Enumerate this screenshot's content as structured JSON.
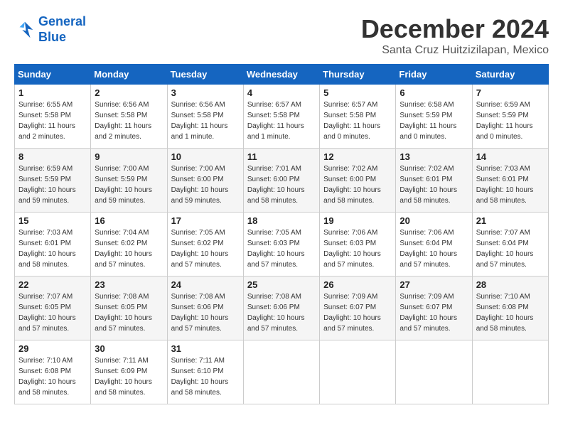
{
  "header": {
    "logo_line1": "General",
    "logo_line2": "Blue",
    "month": "December 2024",
    "location": "Santa Cruz Huitzizilapan, Mexico"
  },
  "weekdays": [
    "Sunday",
    "Monday",
    "Tuesday",
    "Wednesday",
    "Thursday",
    "Friday",
    "Saturday"
  ],
  "weeks": [
    [
      {
        "day": "1",
        "sunrise": "6:55 AM",
        "sunset": "5:58 PM",
        "daylight": "11 hours and 2 minutes."
      },
      {
        "day": "2",
        "sunrise": "6:56 AM",
        "sunset": "5:58 PM",
        "daylight": "11 hours and 2 minutes."
      },
      {
        "day": "3",
        "sunrise": "6:56 AM",
        "sunset": "5:58 PM",
        "daylight": "11 hours and 1 minute."
      },
      {
        "day": "4",
        "sunrise": "6:57 AM",
        "sunset": "5:58 PM",
        "daylight": "11 hours and 1 minute."
      },
      {
        "day": "5",
        "sunrise": "6:57 AM",
        "sunset": "5:58 PM",
        "daylight": "11 hours and 0 minutes."
      },
      {
        "day": "6",
        "sunrise": "6:58 AM",
        "sunset": "5:59 PM",
        "daylight": "11 hours and 0 minutes."
      },
      {
        "day": "7",
        "sunrise": "6:59 AM",
        "sunset": "5:59 PM",
        "daylight": "11 hours and 0 minutes."
      }
    ],
    [
      {
        "day": "8",
        "sunrise": "6:59 AM",
        "sunset": "5:59 PM",
        "daylight": "10 hours and 59 minutes."
      },
      {
        "day": "9",
        "sunrise": "7:00 AM",
        "sunset": "5:59 PM",
        "daylight": "10 hours and 59 minutes."
      },
      {
        "day": "10",
        "sunrise": "7:00 AM",
        "sunset": "6:00 PM",
        "daylight": "10 hours and 59 minutes."
      },
      {
        "day": "11",
        "sunrise": "7:01 AM",
        "sunset": "6:00 PM",
        "daylight": "10 hours and 58 minutes."
      },
      {
        "day": "12",
        "sunrise": "7:02 AM",
        "sunset": "6:00 PM",
        "daylight": "10 hours and 58 minutes."
      },
      {
        "day": "13",
        "sunrise": "7:02 AM",
        "sunset": "6:01 PM",
        "daylight": "10 hours and 58 minutes."
      },
      {
        "day": "14",
        "sunrise": "7:03 AM",
        "sunset": "6:01 PM",
        "daylight": "10 hours and 58 minutes."
      }
    ],
    [
      {
        "day": "15",
        "sunrise": "7:03 AM",
        "sunset": "6:01 PM",
        "daylight": "10 hours and 58 minutes."
      },
      {
        "day": "16",
        "sunrise": "7:04 AM",
        "sunset": "6:02 PM",
        "daylight": "10 hours and 57 minutes."
      },
      {
        "day": "17",
        "sunrise": "7:05 AM",
        "sunset": "6:02 PM",
        "daylight": "10 hours and 57 minutes."
      },
      {
        "day": "18",
        "sunrise": "7:05 AM",
        "sunset": "6:03 PM",
        "daylight": "10 hours and 57 minutes."
      },
      {
        "day": "19",
        "sunrise": "7:06 AM",
        "sunset": "6:03 PM",
        "daylight": "10 hours and 57 minutes."
      },
      {
        "day": "20",
        "sunrise": "7:06 AM",
        "sunset": "6:04 PM",
        "daylight": "10 hours and 57 minutes."
      },
      {
        "day": "21",
        "sunrise": "7:07 AM",
        "sunset": "6:04 PM",
        "daylight": "10 hours and 57 minutes."
      }
    ],
    [
      {
        "day": "22",
        "sunrise": "7:07 AM",
        "sunset": "6:05 PM",
        "daylight": "10 hours and 57 minutes."
      },
      {
        "day": "23",
        "sunrise": "7:08 AM",
        "sunset": "6:05 PM",
        "daylight": "10 hours and 57 minutes."
      },
      {
        "day": "24",
        "sunrise": "7:08 AM",
        "sunset": "6:06 PM",
        "daylight": "10 hours and 57 minutes."
      },
      {
        "day": "25",
        "sunrise": "7:08 AM",
        "sunset": "6:06 PM",
        "daylight": "10 hours and 57 minutes."
      },
      {
        "day": "26",
        "sunrise": "7:09 AM",
        "sunset": "6:07 PM",
        "daylight": "10 hours and 57 minutes."
      },
      {
        "day": "27",
        "sunrise": "7:09 AM",
        "sunset": "6:07 PM",
        "daylight": "10 hours and 57 minutes."
      },
      {
        "day": "28",
        "sunrise": "7:10 AM",
        "sunset": "6:08 PM",
        "daylight": "10 hours and 58 minutes."
      }
    ],
    [
      {
        "day": "29",
        "sunrise": "7:10 AM",
        "sunset": "6:08 PM",
        "daylight": "10 hours and 58 minutes."
      },
      {
        "day": "30",
        "sunrise": "7:11 AM",
        "sunset": "6:09 PM",
        "daylight": "10 hours and 58 minutes."
      },
      {
        "day": "31",
        "sunrise": "7:11 AM",
        "sunset": "6:10 PM",
        "daylight": "10 hours and 58 minutes."
      },
      null,
      null,
      null,
      null
    ]
  ]
}
